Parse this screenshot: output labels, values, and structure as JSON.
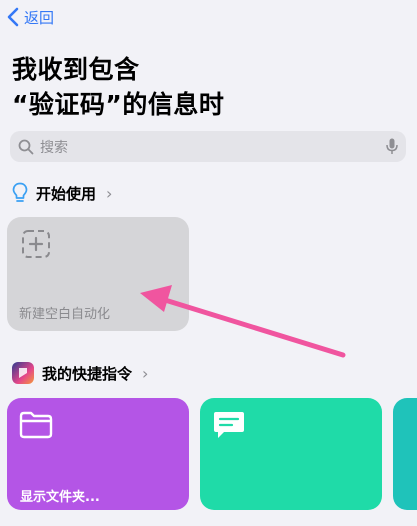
{
  "nav": {
    "back_label": "返回"
  },
  "header": {
    "title_line1": "我收到包含",
    "title_line2": "“验证码”的信息时"
  },
  "search": {
    "placeholder": "搜索"
  },
  "get_started": {
    "label": "开始使用",
    "chevron": "›"
  },
  "new_automation": {
    "label": "新建空白自动化"
  },
  "my_shortcuts": {
    "label": "我的快捷指令",
    "chevron": "›"
  },
  "shortcut_cards": [
    {
      "label": "显示文件夹...",
      "color": "#b455e6",
      "icon": "folder-icon"
    },
    {
      "label": "",
      "color": "#1fdba8",
      "icon": "message-icon"
    },
    {
      "label": "",
      "color": "#1fc3ba",
      "icon": ""
    }
  ],
  "annotation": {
    "color": "#f0559f"
  },
  "colors": {
    "accent": "#3478f6",
    "background": "#f2f2f7"
  }
}
